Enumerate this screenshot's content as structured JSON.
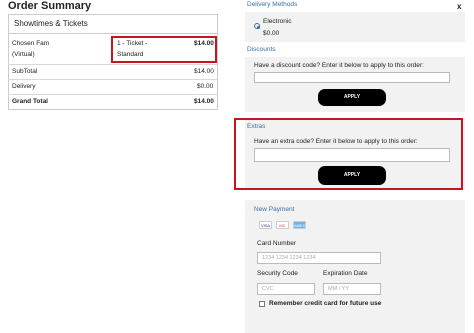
{
  "order_summary": {
    "title": "Order Summary",
    "section_header": "Showtimes & Tickets",
    "item": {
      "name_line1": "Chosen Fam",
      "name_line2": "(Virtual)",
      "ticket_line1": "1 - Ticket -",
      "ticket_line2": "Standard",
      "price": "$14.00"
    },
    "subtotal_label": "SubTotal",
    "subtotal_value": "$14.00",
    "delivery_label": "Delivery",
    "delivery_value": "$0.00",
    "grand_total_label": "Grand Total",
    "grand_total_value": "$14.00"
  },
  "close_label": "x",
  "delivery_methods": {
    "title": "Delivery Methods",
    "option_name": "Electronic",
    "option_price": "$0.00"
  },
  "discounts": {
    "title": "Discounts",
    "prompt": "Have a discount code? Enter it below to apply to this order:",
    "apply_label": "APPLY"
  },
  "extras": {
    "title": "Extras",
    "prompt": "Have an extra code? Enter it below to apply to this order:",
    "apply_label": "APPLY"
  },
  "payment": {
    "title": "New Payment",
    "cards": [
      "VISA",
      "MC",
      "AMEX"
    ],
    "card_number_label": "Card Number",
    "card_number_placeholder": "1234 1234 1234 1234",
    "security_code_label": "Security Code",
    "security_code_placeholder": "CVC",
    "expiration_label": "Expiration Date",
    "expiration_placeholder": "MM / YY",
    "remember_label": "Remember credit card for future use"
  },
  "colors": {
    "accent_blue": "#3a6ea5",
    "highlight_red": "#c8141e",
    "button_black": "#000000"
  }
}
